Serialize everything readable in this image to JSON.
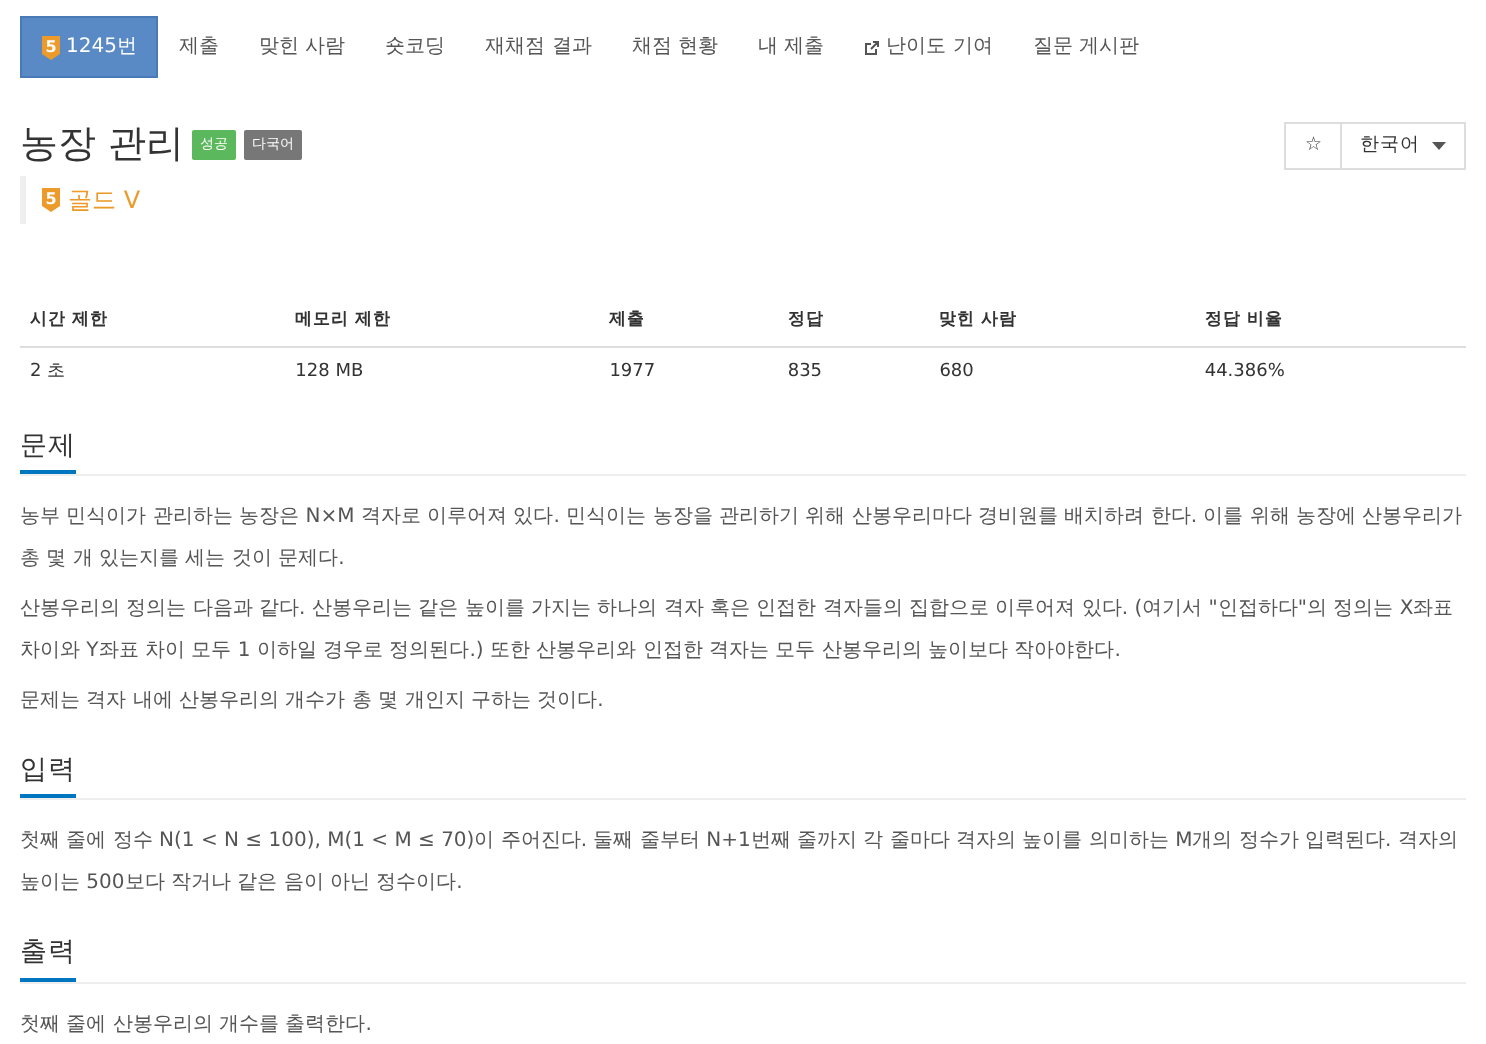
{
  "tabs": [
    {
      "label": "1245번",
      "kind": "problem",
      "tier": "5",
      "selected": true
    },
    {
      "label": "제출",
      "kind": "plain",
      "selected": false
    },
    {
      "label": "맞힌 사람",
      "kind": "plain",
      "selected": false
    },
    {
      "label": "숏코딩",
      "kind": "plain",
      "selected": false
    },
    {
      "label": "재채점 결과",
      "kind": "plain",
      "selected": false
    },
    {
      "label": "채점 현황",
      "kind": "plain",
      "selected": false
    },
    {
      "label": "내 제출",
      "kind": "plain",
      "selected": false
    },
    {
      "label": "난이도 기여",
      "kind": "external",
      "selected": false
    },
    {
      "label": "질문 게시판",
      "kind": "plain",
      "selected": false
    }
  ],
  "title": "농장 관리",
  "labels": [
    {
      "text": "성공",
      "color": "#5cb85c"
    },
    {
      "text": "다국어",
      "color": "#777777"
    }
  ],
  "tier": {
    "level": "5",
    "label": "골드 V"
  },
  "star_button": "☆",
  "language": "한국어",
  "stats": {
    "columns": [
      "시간 제한",
      "메모리 제한",
      "제출",
      "정답",
      "맞힌 사람",
      "정답 비율"
    ],
    "row": [
      "2 초",
      "128 MB",
      "1977",
      "835",
      "680",
      "44.386%"
    ]
  },
  "sections": [
    {
      "heading": "문제",
      "paragraphs": [
        "농부 민식이가 관리하는 농장은 N×M 격자로 이루어져 있다. 민식이는 농장을 관리하기 위해 산봉우리마다 경비원를 배치하려 한다. 이를 위해 농장에 산봉우리가 총 몇 개 있는지를 세는 것이 문제다.",
        "산봉우리의 정의는 다음과 같다. 산봉우리는 같은 높이를 가지는 하나의 격자 혹은 인접한 격자들의 집합으로 이루어져 있다. (여기서 \"인접하다\"의 정의는 X좌표 차이와 Y좌표 차이 모두 1 이하일 경우로 정의된다.) 또한 산봉우리와 인접한 격자는 모두 산봉우리의 높이보다 작아야한다.",
        "문제는 격자 내에 산봉우리의 개수가 총 몇 개인지 구하는 것이다."
      ]
    },
    {
      "heading": "입력",
      "paragraphs": [
        "첫째 줄에 정수 N(1 < N ≤ 100), M(1 < M ≤ 70)이 주어진다. 둘째 줄부터 N+1번째 줄까지 각 줄마다 격자의 높이를 의미하는 M개의 정수가 입력된다. 격자의 높이는 500보다 작거나 같은 음이 아닌 정수이다."
      ]
    },
    {
      "heading": "출력",
      "paragraphs": [
        "첫째 줄에 산봉우리의 개수를 출력한다."
      ]
    }
  ]
}
